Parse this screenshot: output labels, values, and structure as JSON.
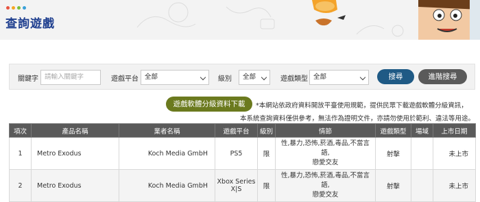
{
  "header": {
    "title": "查詢遊戲",
    "dot_colors": [
      "#e8533f",
      "#f5a623",
      "#7bbf3a",
      "#3aa0d8"
    ]
  },
  "search": {
    "keyword_label": "關鍵字",
    "keyword_placeholder": "請輸入關鍵字",
    "platform_label": "遊戲平台",
    "platform_value": "全部",
    "rating_label": "級別",
    "rating_value": "全部",
    "genre_label": "遊戲類型",
    "genre_value": "全部",
    "search_button": "搜尋",
    "advanced_button": "進階搜尋"
  },
  "download_button": "遊戲軟體分級資料下載",
  "notice": {
    "line1": "*本網站依政府資料開放平臺使用規範，提供民眾下載遊戲軟體分級資訊，",
    "line2": "本系統查詢資料僅供參考，無法作為證明文件，亦請勿使用於範利、違法等用途。"
  },
  "table": {
    "headers": [
      "項次",
      "產品名稱",
      "業者名稱",
      "遊戲平台",
      "級別",
      "情節",
      "遊戲類型",
      "場域",
      "上市日期"
    ],
    "rows": [
      {
        "index": "1",
        "product": "Metro Exodus",
        "company": "Koch Media GmbH",
        "platform": "PS5",
        "rating": "限",
        "content_line1": "性,暴力,恐怖,菸酒,毒品,不當言語,",
        "content_line2": "戀愛交友",
        "genre": "射擊",
        "venue": "",
        "release": "未上市"
      },
      {
        "index": "2",
        "product": "Metro Exodus",
        "company": "Koch Media GmbH",
        "platform_line1": "Xbox Series",
        "platform_line2": "X|S",
        "rating": "限",
        "content_line1": "性,暴力,恐怖,菸酒,毒品,不當言語,",
        "content_line2": "戀愛交友",
        "genre": "射擊",
        "venue": "",
        "release": "未上市"
      }
    ]
  },
  "colors": {
    "title": "#1f3f8f",
    "search_button": "#1f5a85",
    "advanced_button": "#5a5a5a",
    "download_button": "#6b7a1e",
    "table_header": "#5a5a5a"
  }
}
